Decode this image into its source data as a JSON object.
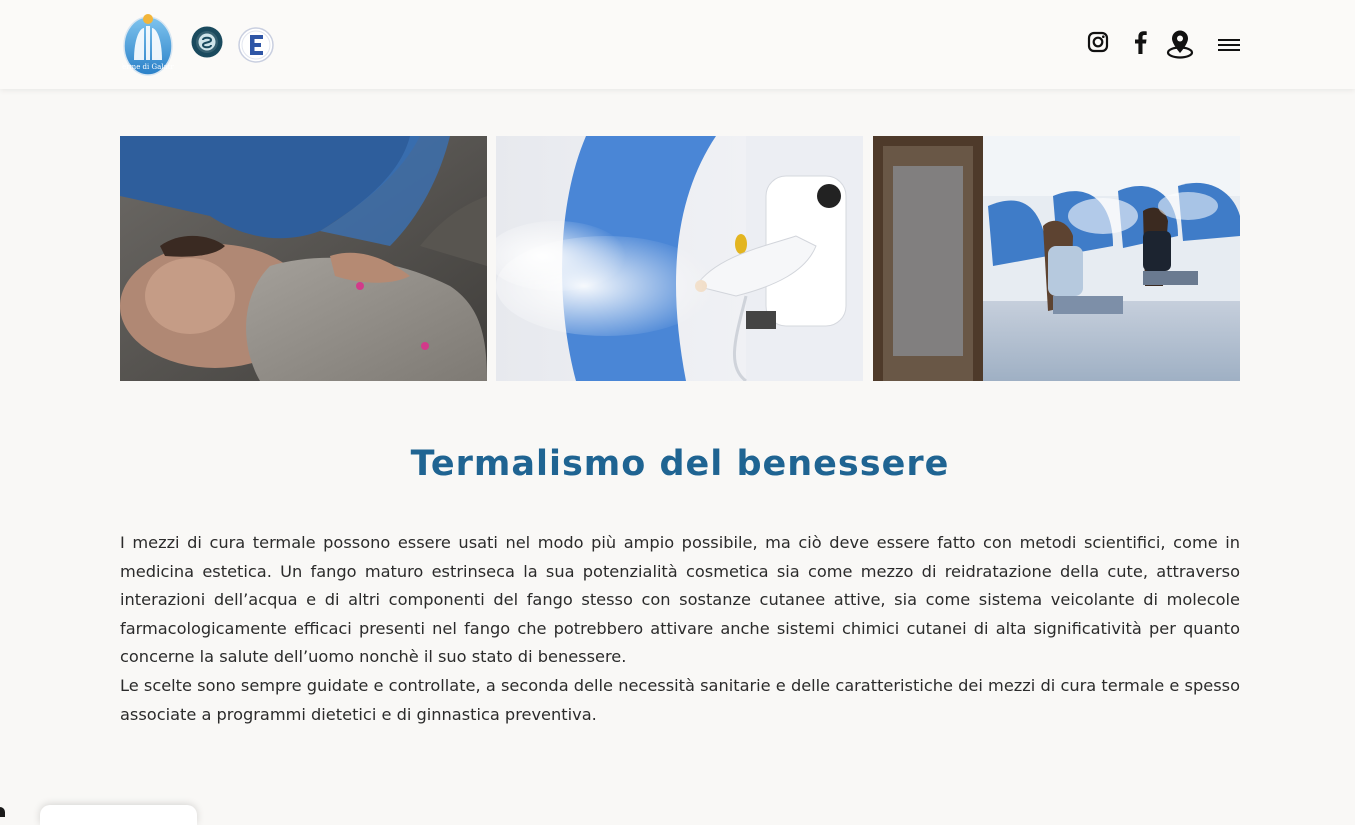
{
  "header": {
    "logos": [
      "terme-galatro-logo",
      "accreditation-seal-logo",
      "e-badge-logo"
    ],
    "logo_text": "Terme di Galatro",
    "social": [
      "instagram-icon",
      "facebook-icon",
      "map-pin-icon",
      "hamburger-menu-icon"
    ]
  },
  "gallery": {
    "photos": [
      "mud-therapy-photo",
      "inhalation-device-photo",
      "inhalation-room-photo"
    ]
  },
  "content": {
    "title": "Termalismo del benessere",
    "paragraph1": "I mezzi di cura termale possono essere usati nel modo più ampio possibile, ma ciò deve essere fatto con metodi scientifici, come in medicina estetica. Un fango maturo estrinseca la sua potenzialità cosmetica sia come mezzo di reidratazione della cute, attraverso interazioni dell’acqua e di altri componenti del fango stesso con sostanze cutanee attive, sia come sistema veicolante di molecole farmacologicamente efficaci presenti nel fango che potrebbero attivare anche sistemi chimici cutanei di alta significatività per quanto concerne la salute dell’uomo nonchè il suo stato di benessere.",
    "paragraph2": "Le scelte sono sempre guidate e controllate, a seconda delle necessità sanitarie e delle caratteristiche dei mezzi di cura termale e spesso associate a programmi dietetici e di ginnastica preventiva."
  },
  "colors": {
    "title": "#1f6492",
    "background": "#f9f8f6",
    "text": "#2b2b2b"
  }
}
